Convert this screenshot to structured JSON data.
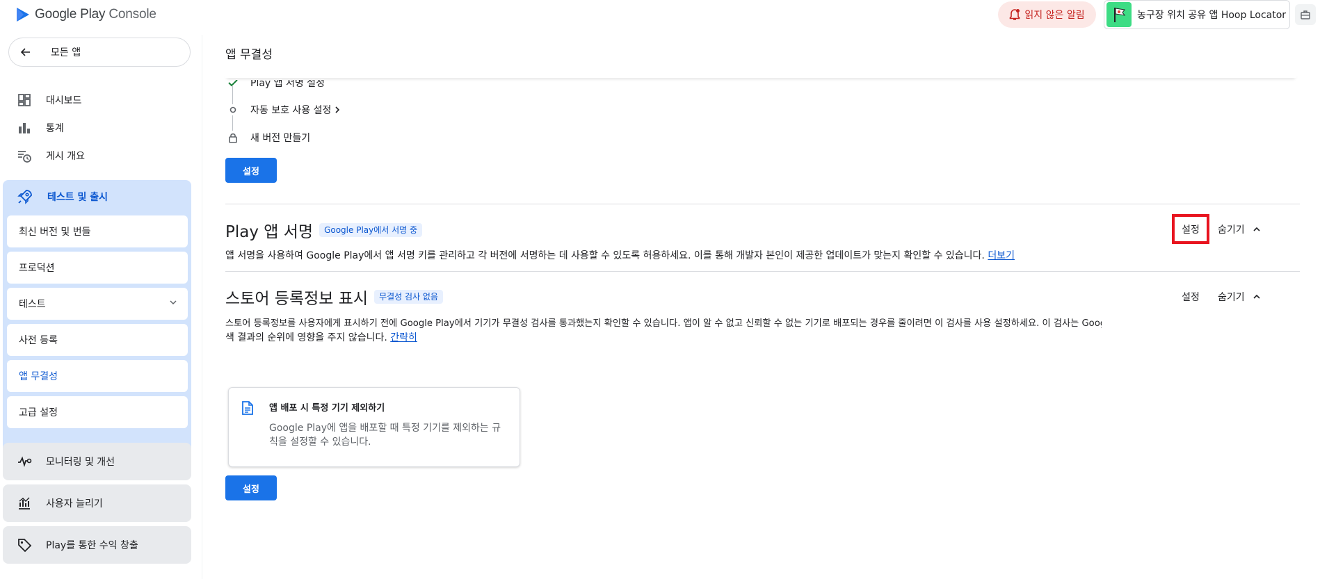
{
  "header": {
    "logo_text_main": "Google Play",
    "logo_text_sub": "Console",
    "alert_label": "읽지 않은 알림",
    "app_name": "농구장 위치 공유 앱 Hoop Locator"
  },
  "sidebar": {
    "back_label": "모든 앱",
    "items": [
      {
        "label": "대시보드",
        "icon": "dashboard-icon"
      },
      {
        "label": "통계",
        "icon": "bar-chart-icon"
      },
      {
        "label": "게시 개요",
        "icon": "publishing-overview-icon"
      }
    ],
    "release_group": {
      "label": "테스트 및 출시",
      "icon": "rocket-icon",
      "sub_items": [
        {
          "label": "최신 버전 및 번들"
        },
        {
          "label": "프로덕션"
        },
        {
          "label": "테스트"
        },
        {
          "label": "사전 등록"
        },
        {
          "label": "앱 무결성"
        },
        {
          "label": "고급 설정"
        }
      ]
    },
    "other_groups": [
      {
        "label": "모니터링 및 개선",
        "icon": "pulse-icon"
      },
      {
        "label": "사용자 늘리기",
        "icon": "grow-users-icon"
      },
      {
        "label": "Play를 통한 수익 창출",
        "icon": "tag-icon"
      }
    ]
  },
  "main": {
    "page_title": "앱 무결성",
    "steps": [
      {
        "label": "Play 앱 서명 설정"
      },
      {
        "label": "자동 보호 사용 설정"
      },
      {
        "label": "새 버전 만들기"
      }
    ],
    "setup_button": "설정",
    "play_signing": {
      "title": "Play 앱 서명",
      "badge": "Google Play에서 서명 중",
      "description": "앱 서명을 사용하여 Google Play에서 앱 서명 키를 관리하고 각 버전에 서명하는 데 사용할 수 있도록 허용하세요. 이를 통해 개발자 본인이 제공한 업데이트가 맞는지 확인할 수 있습니다.",
      "link": "더보기",
      "setup_label": "설정",
      "hide_label": "숨기기"
    },
    "store_listing": {
      "title": "스토어 등록정보 표시",
      "badge": "무결성 검사 없음",
      "description_1": "스토어 등록정보를 사용자에게 표시하기 전에 Google Play에서 기기가 무결성 검사를 통과했는지 확인할 수 있습니다. 앱이 알 수 없고 신뢰할 수 없는 기기로 배포되는 경우를 줄이려면 이 검사를 사용 설정하세요. 이 검사는 Google Play 검색 가능 여부 또는 검",
      "description_2": "색 결과의 순위에 영향을 주지 않습니다.",
      "link": "간략히",
      "setup_label": "설정",
      "hide_label": "숨기기",
      "card_title": "앱 배포 시 특정 기기 제외하기",
      "card_desc": "Google Play에 앱을 배포할 때 특정 기기를 제외하는 규칙을 설정할 수 있습니다.",
      "setup_button": "설정"
    }
  },
  "colors": {
    "primary": "#1a73e8",
    "active_nav_bg": "#d2e3fc",
    "active_text": "#0b57d0",
    "alert_red": "#c5221f",
    "highlight_box": "#e8141f"
  }
}
